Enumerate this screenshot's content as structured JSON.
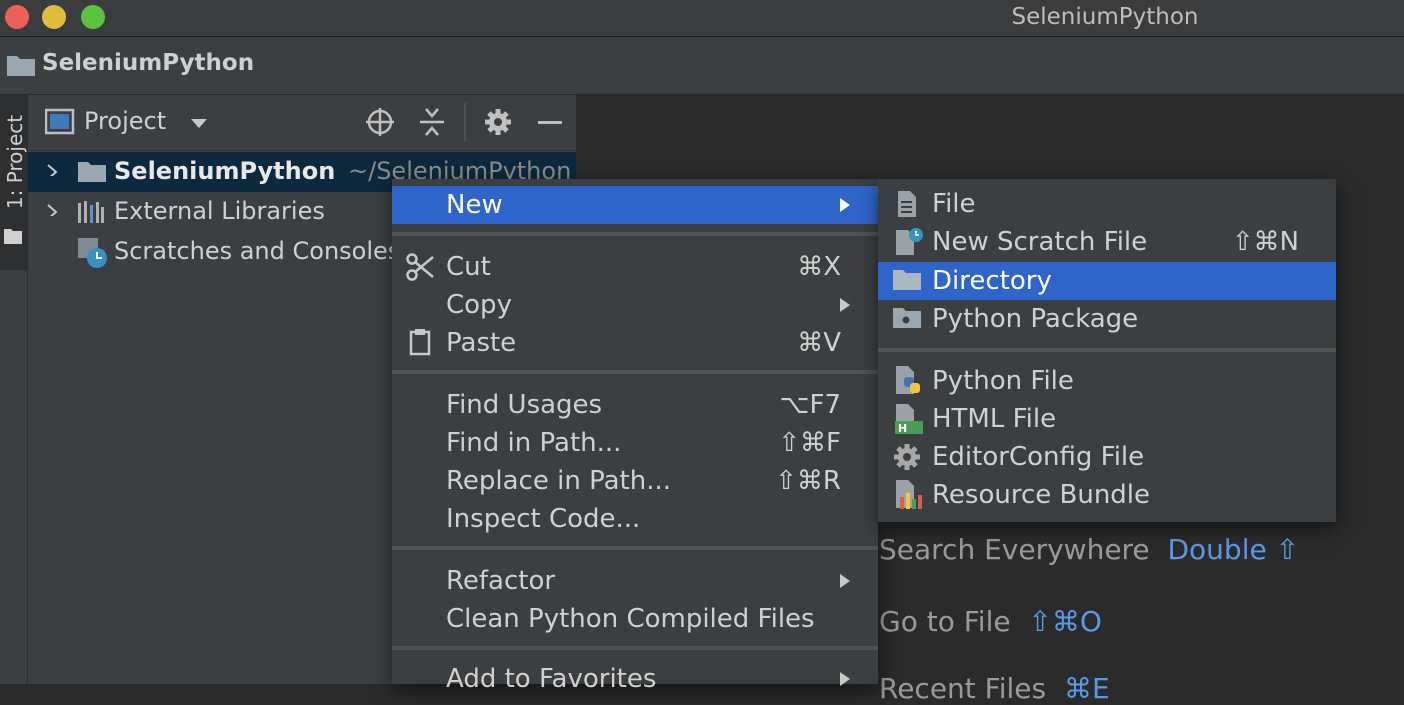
{
  "window": {
    "title": "SeleniumPython"
  },
  "navbar": {
    "breadcrumb": "SeleniumPython"
  },
  "side_stripe": {
    "project_tab": "1: Project"
  },
  "project_panel": {
    "title": "Project",
    "tree": [
      {
        "label": "SeleniumPython",
        "path": "~/SeleniumPython",
        "selected": true,
        "icon": "folder-icon"
      },
      {
        "label": "External Libraries",
        "icon": "libraries-icon"
      },
      {
        "label": "Scratches and Consoles",
        "icon": "scratches-icon"
      }
    ]
  },
  "context_menu": {
    "items": [
      {
        "label": "New",
        "shortcut": "",
        "submenu": true,
        "highlighted": true
      },
      {
        "label": "Cut",
        "shortcut": "⌘X",
        "icon": "scissors-icon"
      },
      {
        "label": "Copy",
        "shortcut": "",
        "submenu": true
      },
      {
        "label": "Paste",
        "shortcut": "⌘V",
        "icon": "clipboard-icon"
      },
      {
        "label": "Find Usages",
        "shortcut": "⌥F7"
      },
      {
        "label": "Find in Path...",
        "shortcut": "⇧⌘F"
      },
      {
        "label": "Replace in Path...",
        "shortcut": "⇧⌘R"
      },
      {
        "label": "Inspect Code..."
      },
      {
        "label": "Refactor",
        "submenu": true
      },
      {
        "label": "Clean Python Compiled Files"
      },
      {
        "label": "Add to Favorites",
        "submenu": true
      }
    ]
  },
  "new_submenu": {
    "items": [
      {
        "label": "File",
        "icon": "file-icon"
      },
      {
        "label": "New Scratch File",
        "shortcut": "⇧⌘N",
        "icon": "scratch-file-icon"
      },
      {
        "label": "Directory",
        "icon": "directory-icon",
        "highlighted": true
      },
      {
        "label": "Python Package",
        "icon": "python-package-icon"
      },
      {
        "label": "Python File",
        "icon": "python-file-icon"
      },
      {
        "label": "HTML File",
        "icon": "html-file-icon"
      },
      {
        "label": "EditorConfig File",
        "icon": "editorconfig-icon"
      },
      {
        "label": "Resource Bundle",
        "icon": "resource-bundle-icon"
      }
    ]
  },
  "editor_hints": [
    {
      "label": "Search Everywhere",
      "shortcut": "Double ⇧"
    },
    {
      "label": "Go to File",
      "shortcut": "⇧⌘O"
    },
    {
      "label": "Recent Files",
      "shortcut": "⌘E"
    }
  ],
  "colors": {
    "accent": "#2f65ca",
    "hint_key": "#5899e8",
    "background": "#2b2b2b",
    "panel": "#3c3f41"
  }
}
